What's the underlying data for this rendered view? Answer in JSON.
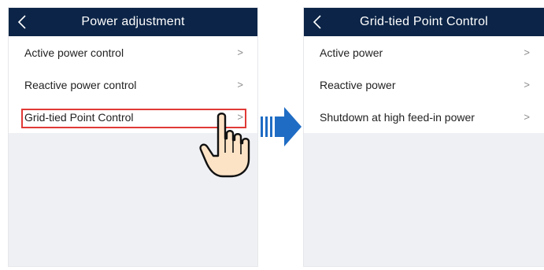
{
  "left_screen": {
    "title": "Power adjustment",
    "items": [
      {
        "label": "Active power control"
      },
      {
        "label": "Reactive power control"
      },
      {
        "label": "Grid-tied Point Control"
      }
    ]
  },
  "right_screen": {
    "title": "Grid-tied Point Control",
    "items": [
      {
        "label": "Active power"
      },
      {
        "label": "Reactive power"
      },
      {
        "label": "Shutdown at high feed-in power"
      }
    ]
  },
  "chevron": ">",
  "colors": {
    "header": "#0b2447",
    "highlight": "#e03a36",
    "arrow": "#1f6cc4",
    "background": "#eff0f4"
  }
}
